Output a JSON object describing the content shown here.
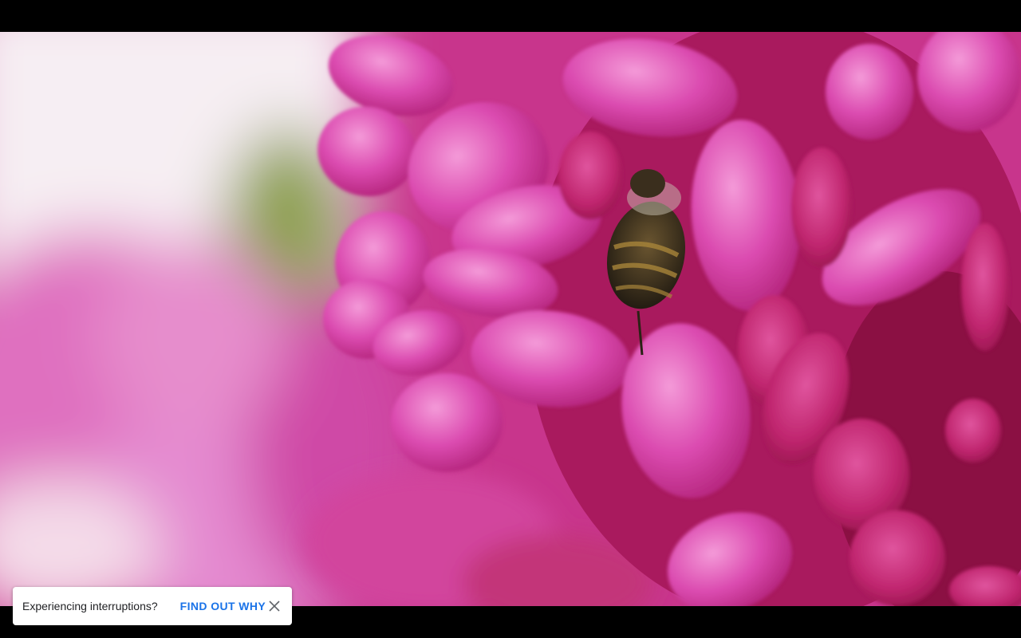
{
  "video": {
    "subject": "pink flower cluster with bee",
    "colors": {
      "blossom": "#d63fa6",
      "blossom_light": "#f07fcd",
      "blossom_dark": "#b0185f",
      "blur_pink": "#e77fc6",
      "background_white": "#f4eef2",
      "leaf_green": "#8fa050",
      "bee_body": "#3b3221",
      "bee_stripe": "#a8843a"
    }
  },
  "toast": {
    "message": "Experiencing interruptions?",
    "action_label": "FIND OUT WHY",
    "close_icon": "close-icon",
    "accent_color": "#1a73e8"
  }
}
